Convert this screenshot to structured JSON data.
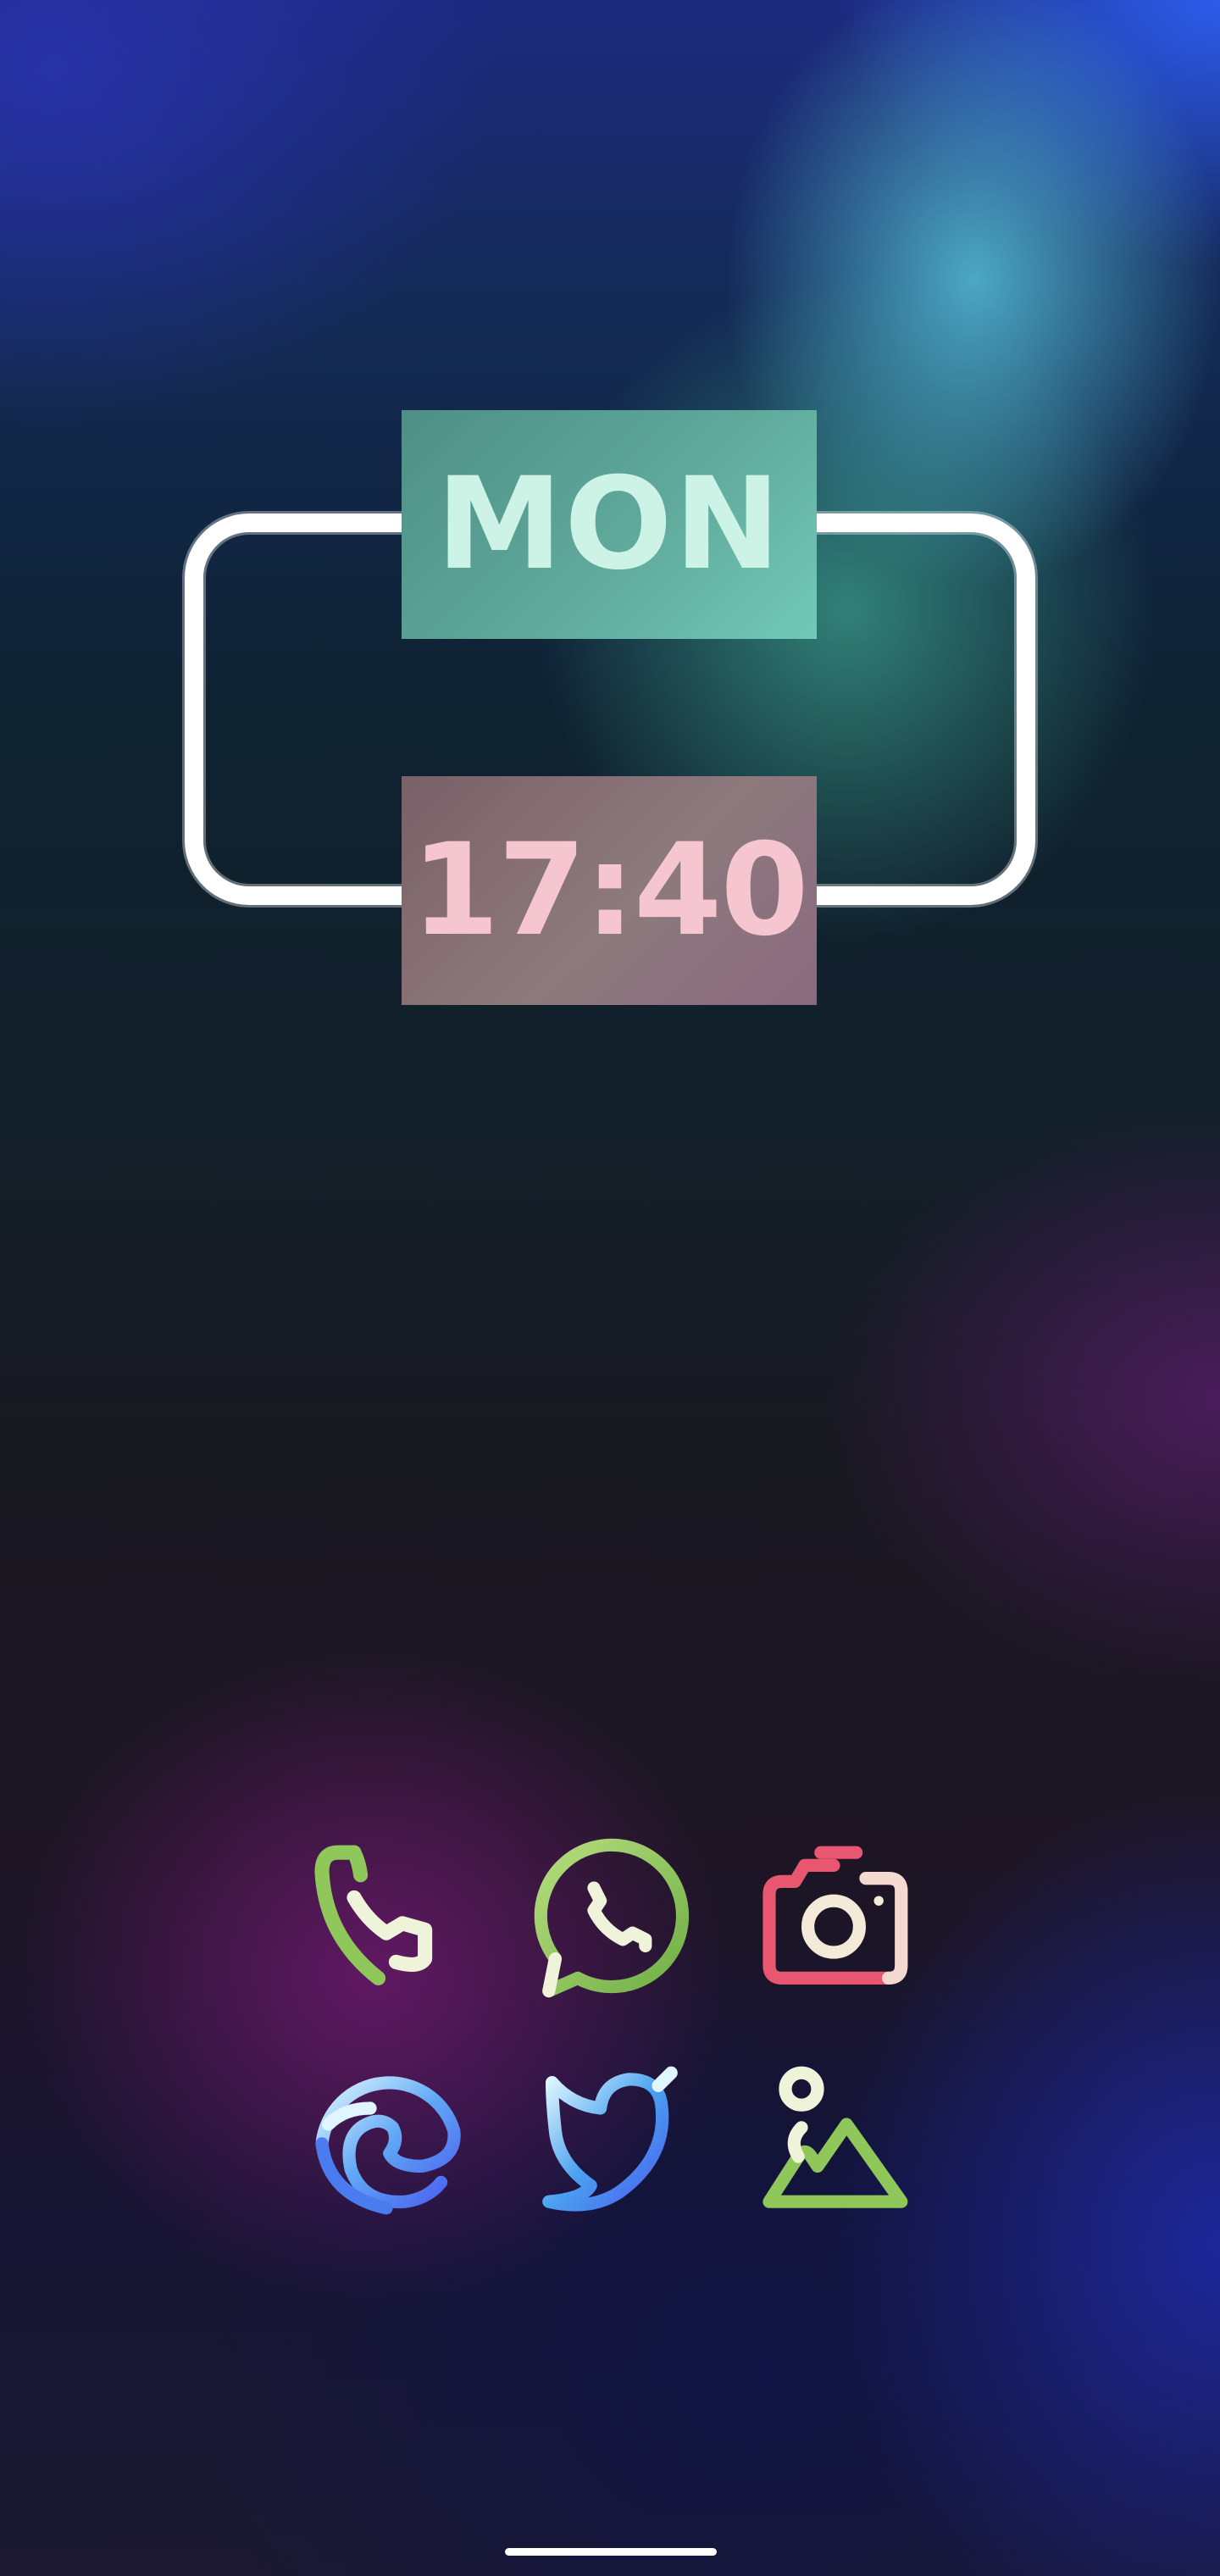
{
  "widget": {
    "day": "MON",
    "time": "17:40"
  },
  "dock": {
    "row1": [
      {
        "name": "phone",
        "icon": "phone-icon"
      },
      {
        "name": "whatsapp",
        "icon": "whatsapp-icon"
      },
      {
        "name": "camera",
        "icon": "camera-icon"
      }
    ],
    "row2": [
      {
        "name": "edge",
        "icon": "edge-browser-icon"
      },
      {
        "name": "twitter",
        "icon": "twitter-bird-icon"
      },
      {
        "name": "gallery",
        "icon": "gallery-icon"
      }
    ]
  },
  "colors": {
    "icon_green": "#8fc75a",
    "icon_cream": "#eef3da",
    "icon_pink": "#e8566f",
    "icon_blue": "#4a7cf0",
    "icon_light": "#dff6ff"
  }
}
